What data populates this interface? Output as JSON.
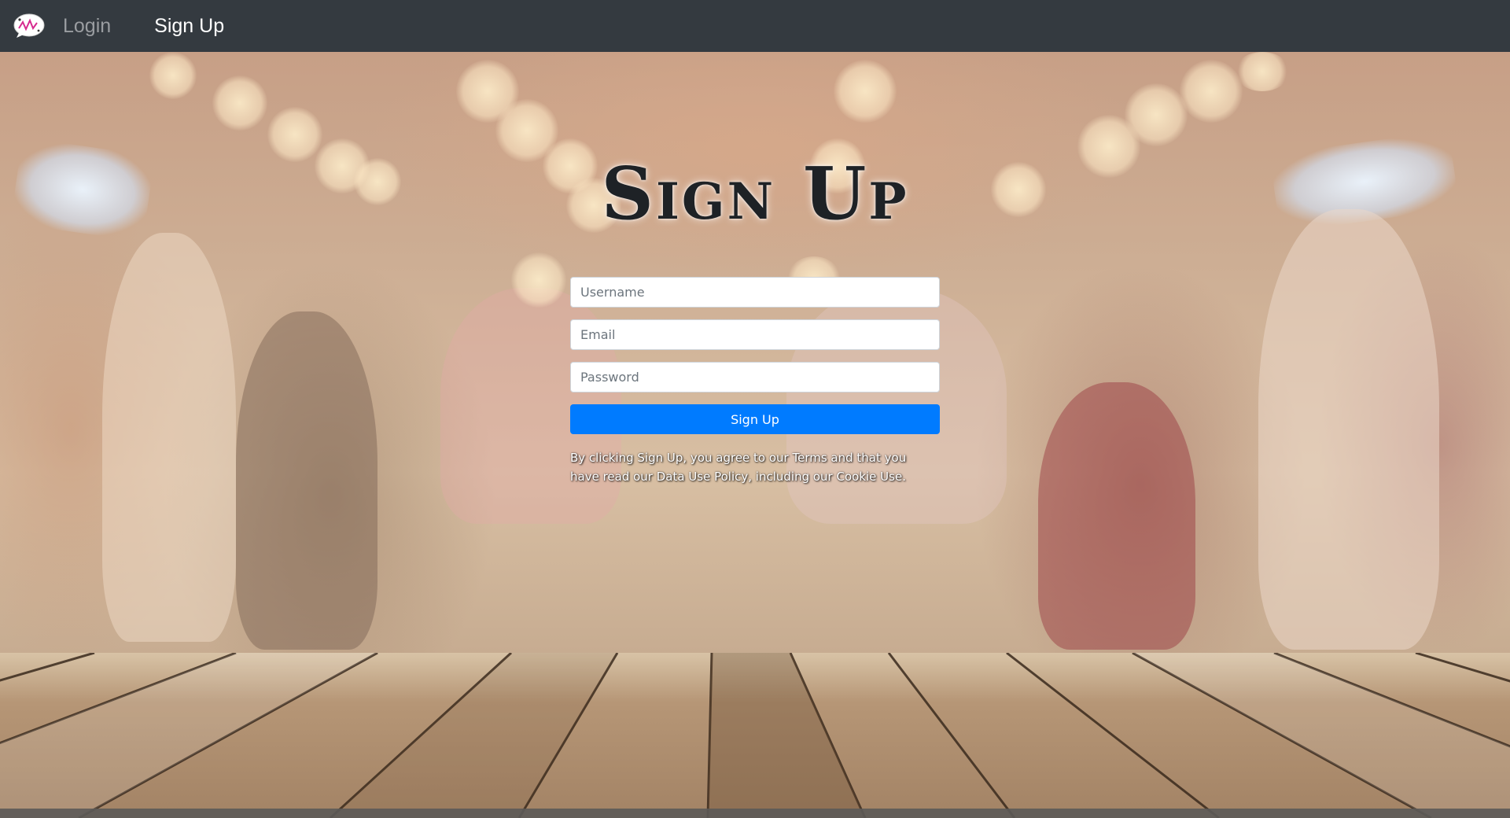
{
  "navbar": {
    "logo_icon": "speech-bubble-logo-icon",
    "links": [
      {
        "label": "Login",
        "state": "inactive"
      },
      {
        "label": "Sign Up",
        "state": "active"
      }
    ],
    "background": "#343a40"
  },
  "form": {
    "title": "Sign Up",
    "username_placeholder": "Username",
    "email_placeholder": "Email",
    "password_placeholder": "Password",
    "submit_label": "Sign Up",
    "terms_text": "By clicking Sign Up, you agree to our Terms and that you have read our Data Use Policy, including our Cookie Use."
  },
  "colors": {
    "primary_button": "#007bff",
    "title_text": "#1e2226"
  }
}
